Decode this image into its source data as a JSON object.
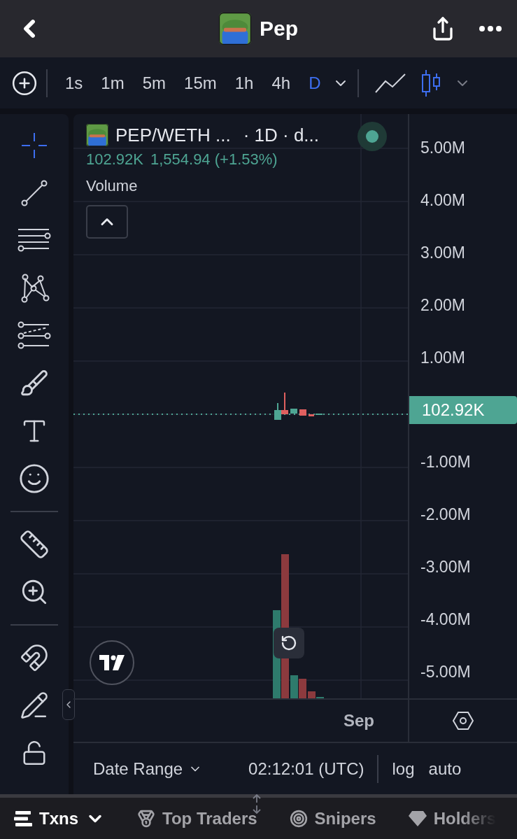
{
  "header": {
    "title": "Pep"
  },
  "toolbar": {
    "timeframes": [
      {
        "label": "1s",
        "selected": false
      },
      {
        "label": "1m",
        "selected": false
      },
      {
        "label": "5m",
        "selected": false
      },
      {
        "label": "15m",
        "selected": false
      },
      {
        "label": "1h",
        "selected": false
      },
      {
        "label": "4h",
        "selected": false
      },
      {
        "label": "D",
        "selected": true
      }
    ],
    "chart_types": [
      {
        "kind": "line",
        "selected": false
      },
      {
        "kind": "candles",
        "selected": true
      }
    ]
  },
  "tool_groups": [
    {
      "tools": [
        {
          "selected": true
        },
        {
          "selected": false
        },
        {
          "selected": false
        },
        {
          "selected": false
        },
        {
          "selected": false
        },
        {
          "selected": false
        },
        {
          "selected": false
        },
        {
          "selected": false
        }
      ]
    },
    {
      "tools": [
        {
          "selected": false
        },
        {
          "selected": false
        }
      ]
    },
    {
      "tools": [
        {
          "selected": false
        },
        {
          "selected": false
        },
        {
          "selected": false
        }
      ]
    }
  ],
  "legend": {
    "symbol": "PEP/WETH ...",
    "interval": "· 1D · d...",
    "live": true,
    "last": "102.92K",
    "change": "1,554.94 (+1.53%)",
    "indicator": "Volume"
  },
  "price_axis": [
    {
      "kind": "tick",
      "text": "5.00M"
    },
    {
      "kind": "tick",
      "text": "4.00M"
    },
    {
      "kind": "tick",
      "text": "3.00M"
    },
    {
      "kind": "tick",
      "text": "2.00M"
    },
    {
      "kind": "tick",
      "text": "1.00M"
    },
    {
      "kind": "current",
      "text": "102.92K"
    },
    {
      "kind": "tick",
      "text": "-1.00M"
    },
    {
      "kind": "tick",
      "text": "-2.00M"
    },
    {
      "kind": "tick",
      "text": "-3.00M"
    },
    {
      "kind": "tick",
      "text": "-4.00M"
    },
    {
      "kind": "tick",
      "text": "-5.00M"
    }
  ],
  "time_axis": {
    "labels": [
      "Sep"
    ]
  },
  "footer": {
    "date_range": "Date Range",
    "time": "02:12:01 (UTC)",
    "scale_options": [
      "log",
      "auto"
    ]
  },
  "bottom_tabs": [
    {
      "label": "Txns",
      "selected": true
    },
    {
      "label": "Top Traders",
      "selected": false
    },
    {
      "label": "Snipers",
      "selected": false
    },
    {
      "label": "Holders",
      "selected": false
    }
  ]
}
